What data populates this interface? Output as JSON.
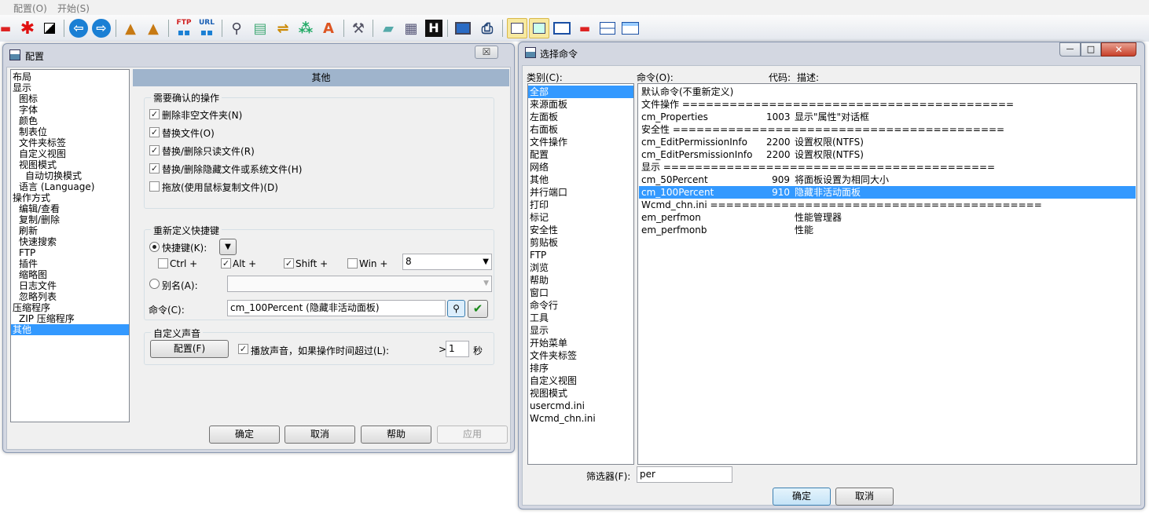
{
  "menu": {
    "config": "配置(O)",
    "start": "开始(S)"
  },
  "toolbar_icons": [
    "minus-icon",
    "red-star-icon",
    "invert-icon",
    "back-arrow-icon",
    "forward-arrow-icon",
    "pack-icon",
    "unpack-icon",
    "ftp-icon",
    "url-icon",
    "search-icon",
    "document-icon",
    "sync-icon",
    "tree-icon",
    "rename-icon",
    "hammer-icon",
    "notepad-icon",
    "calculator-icon",
    "h-icon",
    "monitor-icon",
    "network-icon",
    "panel-icon",
    "panel2-icon",
    "window-icon",
    "red-minus-icon",
    "split-icon",
    "layout-icon"
  ],
  "config_dialog": {
    "title": "配置",
    "close": "☒",
    "tree": [
      "布局",
      "显示",
      "图标",
      "字体",
      "颜色",
      "制表位",
      "文件夹标签",
      "自定义视图",
      "视图模式",
      "自动切换模式",
      "语言 (Language)",
      "操作方式",
      "编辑/查看",
      "复制/删除",
      "刷新",
      "快速搜索",
      "FTP",
      "插件",
      "缩略图",
      "日志文件",
      "忽略列表",
      "压缩程序",
      "ZIP 压缩程序",
      "其他"
    ],
    "panel_header": "其他",
    "confirm_group": "需要确认的操作",
    "confirm_items": [
      {
        "label": "删除非空文件夹(N)",
        "checked": true
      },
      {
        "label": "替换文件(O)",
        "checked": true
      },
      {
        "label": "替换/删除只读文件(R)",
        "checked": true
      },
      {
        "label": "替换/删除隐藏文件或系统文件(H)",
        "checked": true
      },
      {
        "label": "拖放(使用鼠标复制文件)(D)",
        "checked": false
      }
    ],
    "hotkey_group": "重新定义快捷键",
    "hotkey_radio": "快捷键(K):",
    "hotkey_dropdown": "▼",
    "mods": [
      {
        "label": "Ctrl +",
        "checked": false
      },
      {
        "label": "Alt +",
        "checked": true
      },
      {
        "label": "Shift +",
        "checked": true
      },
      {
        "label": "Win +",
        "checked": false
      }
    ],
    "key_value": "8",
    "alias_radio": "别名(A):",
    "alias_value": "",
    "command_label": "命令(C):",
    "command_value": "cm_100Percent (隐藏非活动面板)",
    "sound_group": "自定义声音",
    "sound_button": "配置(F)",
    "sound_check": "播放声音，如果操作时间超过(L):",
    "sound_gt": ">",
    "sound_value": "1",
    "sound_unit": "秒",
    "buttons": {
      "ok": "确定",
      "cancel": "取消",
      "help": "帮助",
      "apply": "应用"
    }
  },
  "command_dialog": {
    "title": "选择命令",
    "category_label": "类别(C):",
    "command_label": "命令(O):",
    "code_label": "代码:",
    "desc_label": "描述:",
    "categories": [
      "全部",
      "来源面板",
      "左面板",
      "右面板",
      "文件操作",
      "配置",
      "网络",
      "其他",
      "并行端口",
      "打印",
      "标记",
      "安全性",
      "剪贴板",
      "FTP",
      "浏览",
      "帮助",
      "窗口",
      "命令行",
      "工具",
      "显示",
      "开始菜单",
      "文件夹标签",
      "排序",
      "自定义视图",
      "视图模式",
      "usercmd.ini",
      "Wcmd_chn.ini"
    ],
    "commands": [
      {
        "name": "默认命令(不重新定义)",
        "code": "",
        "desc": ""
      },
      {
        "name": "文件操作 ==========================================",
        "code": "",
        "desc": ""
      },
      {
        "name": "cm_Properties",
        "code": "1003",
        "desc": "显示\"属性\"对话框"
      },
      {
        "name": "安全性 ==========================================",
        "code": "",
        "desc": ""
      },
      {
        "name": "cm_EditPermissionInfo",
        "code": "2200",
        "desc": "设置权限(NTFS)"
      },
      {
        "name": "cm_EditPersmissionInfo",
        "code": "2200",
        "desc": "设置权限(NTFS)"
      },
      {
        "name": "显示 ==========================================",
        "code": "",
        "desc": ""
      },
      {
        "name": "cm_50Percent",
        "code": "909",
        "desc": "将面板设置为相同大小"
      },
      {
        "name": "cm_100Percent",
        "code": "910",
        "desc": "隐藏非活动面板"
      },
      {
        "name": "Wcmd_chn.ini ==========================================",
        "code": "",
        "desc": ""
      },
      {
        "name": "em_perfmon",
        "code": "",
        "desc": "性能管理器"
      },
      {
        "name": "em_perfmonb",
        "code": "",
        "desc": "性能"
      }
    ],
    "filter_label": "筛选器(F):",
    "filter_value": "per",
    "buttons": {
      "ok": "确定",
      "cancel": "取消"
    },
    "window_controls": {
      "min": "—",
      "max": "□",
      "close": "✕"
    }
  }
}
